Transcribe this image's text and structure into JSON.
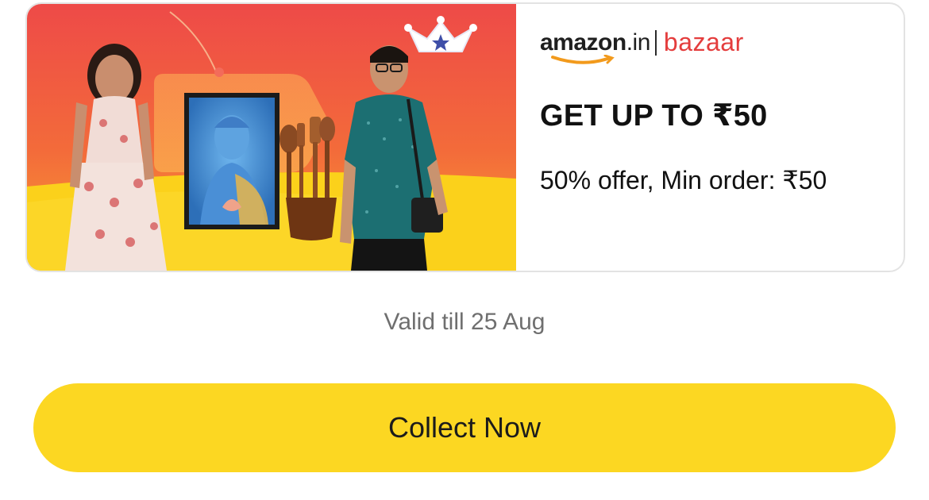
{
  "coupon": {
    "brand": {
      "amazon": "amazon",
      "tld": ".in",
      "bazaar": "bazaar"
    },
    "title": "GET UP TO ₹50",
    "terms": "50% offer, Min order: ₹50"
  },
  "validity": "Valid till 25 Aug",
  "cta": {
    "label": "Collect Now"
  },
  "colors": {
    "banner_top": "#ef4a4a",
    "banner_bottom": "#fbd11b",
    "cta_background": "#fcd722",
    "bazaar_red": "#e43d3d"
  },
  "icons": {
    "crown": "crown-icon",
    "smile": "amazon-smile-icon"
  }
}
